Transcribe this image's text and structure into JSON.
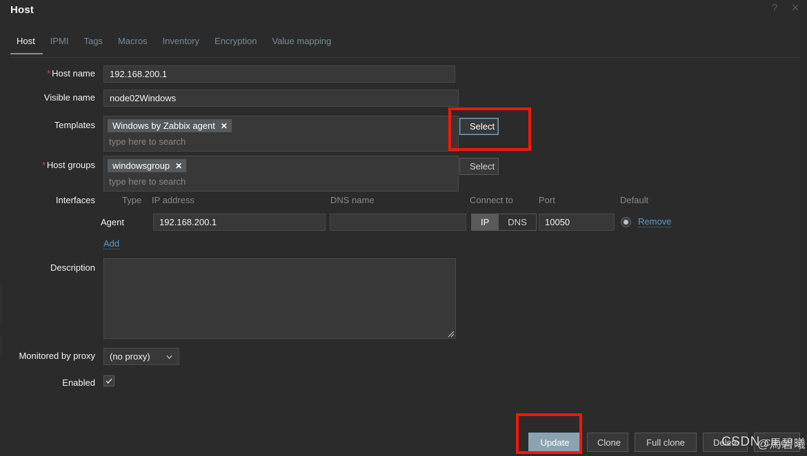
{
  "window": {
    "title": "Host",
    "help_icon": "help-icon",
    "help_glyph": "?",
    "close_icon": "close-icon",
    "close_glyph": "×"
  },
  "tabs": [
    {
      "label": "Host",
      "active": true
    },
    {
      "label": "IPMI",
      "active": false
    },
    {
      "label": "Tags",
      "active": false
    },
    {
      "label": "Macros",
      "active": false
    },
    {
      "label": "Inventory",
      "active": false
    },
    {
      "label": "Encryption",
      "active": false
    },
    {
      "label": "Value mapping",
      "active": false
    }
  ],
  "form": {
    "host_name": {
      "label": "Host name",
      "required": true,
      "required_mark": "*",
      "value": "192.168.200.1"
    },
    "visible_name": {
      "label": "Visible name",
      "required": false,
      "value": "node02Windows"
    },
    "templates": {
      "label": "Templates",
      "required": false,
      "chips": [
        {
          "text": "Windows by Zabbix agent",
          "remove_glyph": "✕"
        }
      ],
      "placeholder": "type here to search",
      "select_button": "Select",
      "select_focused": true
    },
    "host_groups": {
      "label": "Host groups",
      "required": true,
      "required_mark": "*",
      "chips": [
        {
          "text": "windowsgroup",
          "remove_glyph": "✕"
        }
      ],
      "placeholder": "type here to search",
      "select_button": "Select"
    },
    "interfaces": {
      "label": "Interfaces",
      "columns": {
        "type": "Type",
        "ip_address": "IP address",
        "dns_name": "DNS name",
        "connect_to": "Connect to",
        "port": "Port",
        "default": "Default"
      },
      "rows": [
        {
          "type": "Agent",
          "ip_address": "192.168.200.1",
          "dns_name": "",
          "connect_to_options": [
            "IP",
            "DNS"
          ],
          "connect_to_selected": "IP",
          "port": "10050",
          "default_selected": true,
          "remove_label": "Remove"
        }
      ],
      "add_label": "Add"
    },
    "description": {
      "label": "Description",
      "value": "",
      "placeholder": ""
    },
    "monitored_by_proxy": {
      "label": "Monitored by proxy",
      "value": "(no proxy)",
      "options": [
        "(no proxy)"
      ]
    },
    "enabled": {
      "label": "Enabled",
      "checked": true,
      "check_glyph": "✓"
    }
  },
  "footer": {
    "buttons": [
      {
        "label": "Update",
        "style": "primary",
        "highlighted": true
      },
      {
        "label": "Clone",
        "style": "secondary",
        "highlighted": false
      },
      {
        "label": "Full clone",
        "style": "secondary",
        "highlighted": false
      },
      {
        "label": "Delete",
        "style": "secondary",
        "highlighted": false
      },
      {
        "label": "Cancel",
        "style": "secondary",
        "highlighted": false
      }
    ]
  },
  "annotations": [
    {
      "name": "templates-select-highlight"
    },
    {
      "name": "update-button-highlight"
    }
  ],
  "watermark": {
    "brand": "CSDN",
    "author": "@馬碧曦"
  },
  "colors": {
    "background": "#2b2b2b",
    "field_background": "#383838",
    "text": "#f2f2f2",
    "muted_text": "#8a8a8a",
    "link": "#5a9ccc",
    "tab_inactive": "#768d99",
    "required": "#d24c4c",
    "primary_button": "#8ba3b0",
    "annotation": "#fb1606"
  }
}
